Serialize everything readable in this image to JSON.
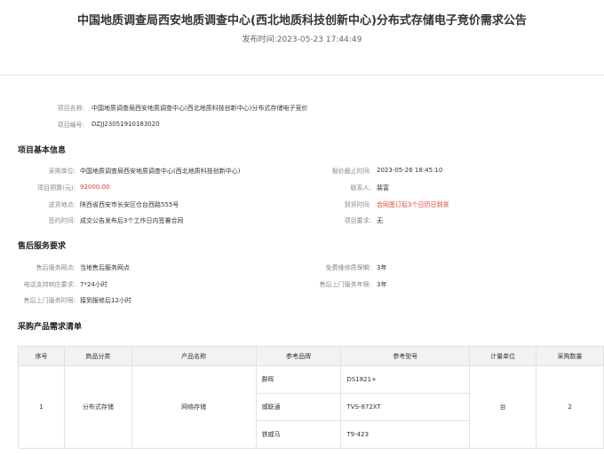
{
  "header": {
    "title": "中国地质调查局西安地质调查中心(西北地质科技创新中心)分布式存储电子竞价需求公告",
    "publish_label": "发布时间:",
    "publish_time": "2023-05-23 17:44:49"
  },
  "project": {
    "name_label": "项目名称:",
    "name_value": "中国地质调查局西安地质调查中心(西北地质科技创新中心)分布式存储电子竞价",
    "code_label": "项目编号:",
    "code_value": "DZJJ23051910183020"
  },
  "basic_info": {
    "heading": "项目基本信息",
    "purchaser_label": "采购单位:",
    "purchaser_value": "中国地质调查局西安地质调查中心(西北地质科技创新中心)",
    "deadline_label": "报价截止时间:",
    "deadline_value": "2023-05-26 18:45:10",
    "budget_label": "项目预算(元):",
    "budget_value": "92000.00",
    "contact_label": "联系人:",
    "contact_value": "裴富",
    "address_label": "送货地点:",
    "address_value": "陕西省西安市长安区仓台西路555号",
    "arrival_label": "到货时间:",
    "arrival_value": "合同签订后3个日历日到货",
    "sign_label": "签约时间:",
    "sign_value": "成交公告发布后3个工作日内签署合同",
    "req_label": "项目要求:",
    "req_value": "无"
  },
  "after_sales": {
    "heading": "售后服务要求",
    "point_label": "售后服务网点:",
    "point_value": "当地售后服务网点",
    "warranty_label": "免费维修质保期:",
    "warranty_value": "3年",
    "phone_label": "电话支持响应要求:",
    "phone_value": "7*24小时",
    "service_years_label": "售后上门服务年限:",
    "service_years_value": "3年",
    "onsite_label": "售后上门服务时限:",
    "onsite_value": "接到报修后12小时"
  },
  "product_list": {
    "heading": "采购产品需求清单",
    "columns": [
      "序号",
      "商品分类",
      "产品名称",
      "参考品牌",
      "参考型号",
      "计量单位",
      "采购数量"
    ],
    "row": {
      "index": "1",
      "category": "分布式存储",
      "product": "网络存储",
      "unit": "台",
      "quantity": "2",
      "refs": [
        {
          "brand": "群晖",
          "model": "DS1821+"
        },
        {
          "brand": "威联通",
          "model": "TVS-872XT"
        },
        {
          "brand": "铁威马",
          "model": "T9-423"
        }
      ]
    }
  }
}
